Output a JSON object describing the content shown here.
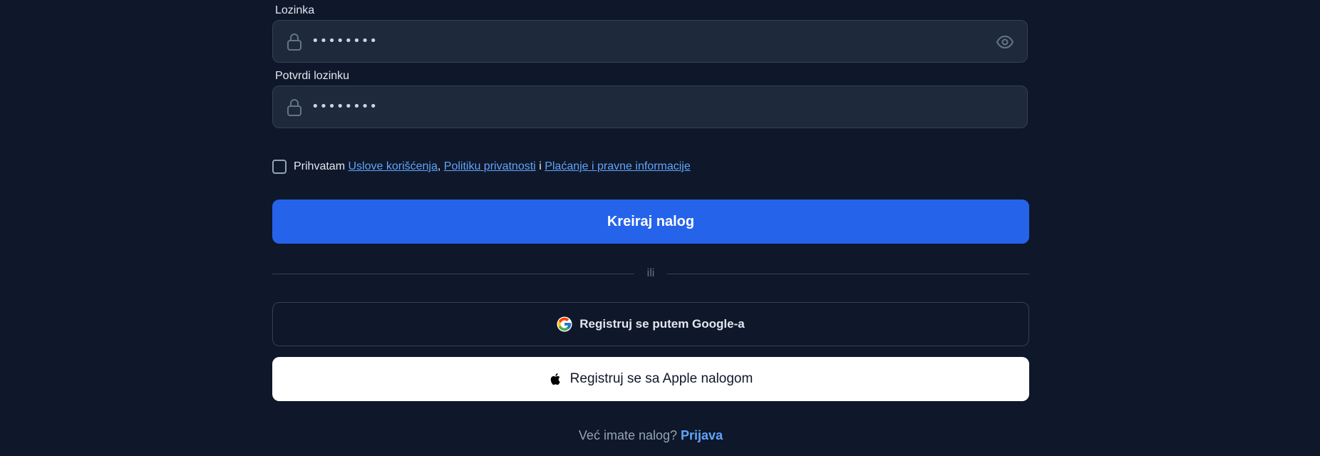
{
  "password": {
    "label": "Lozinka",
    "value": "••••••••",
    "lock_icon": "lock-icon",
    "toggle_icon": "eye-icon"
  },
  "confirm_password": {
    "label": "Potvrdi lozinku",
    "value": "••••••••",
    "lock_icon": "lock-icon"
  },
  "consent": {
    "prefix": "Prihvatam",
    "terms_link": "Uslove korišćenja",
    "comma": ",",
    "privacy_link": "Politiku privatnosti",
    "and": "i",
    "payments_link": "Plaćanje i pravne informacije",
    "checked": false
  },
  "submit": {
    "label": "Kreiraj nalog"
  },
  "divider": {
    "label": "ili"
  },
  "google": {
    "label": "Registruj se putem Google-a",
    "icon": "google-icon"
  },
  "apple": {
    "label": "Registruj se sa Apple nalogom",
    "icon": "apple-icon"
  },
  "footer": {
    "question": "Već imate nalog?",
    "login_link": "Prijava"
  },
  "colors": {
    "background": "#0f172a",
    "input_bg": "#1e293b",
    "primary": "#2563eb",
    "link": "#60a5fa"
  }
}
